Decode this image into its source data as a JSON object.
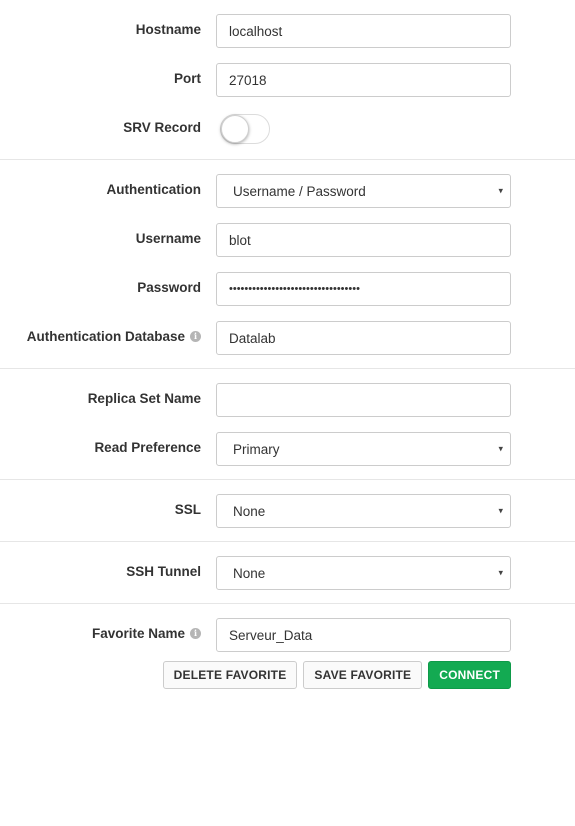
{
  "server": {
    "hostname_label": "Hostname",
    "hostname_value": "localhost",
    "port_label": "Port",
    "port_value": "27018",
    "srv_label": "SRV Record",
    "srv_enabled": false
  },
  "auth": {
    "authentication_label": "Authentication",
    "authentication_value": "Username / Password",
    "username_label": "Username",
    "username_value": "blot",
    "password_label": "Password",
    "password_value": "••••••••••••••••••••••••••••••••••",
    "auth_db_label": "Authentication Database",
    "auth_db_value": "Datalab",
    "info_glyph": "i"
  },
  "replica": {
    "replica_set_label": "Replica Set Name",
    "replica_set_value": "",
    "read_pref_label": "Read Preference",
    "read_pref_value": "Primary"
  },
  "ssl": {
    "label": "SSL",
    "value": "None"
  },
  "ssh": {
    "label": "SSH Tunnel",
    "value": "None"
  },
  "favorite": {
    "label": "Favorite Name",
    "value": "Serveur_Data",
    "delete_button": "DELETE FAVORITE",
    "save_button": "SAVE FAVORITE",
    "connect_button": "CONNECT"
  },
  "select_caret": "▾",
  "colors": {
    "connect_green": "#13aa52",
    "border": "#cccccc",
    "divider": "#e6e6e6"
  }
}
